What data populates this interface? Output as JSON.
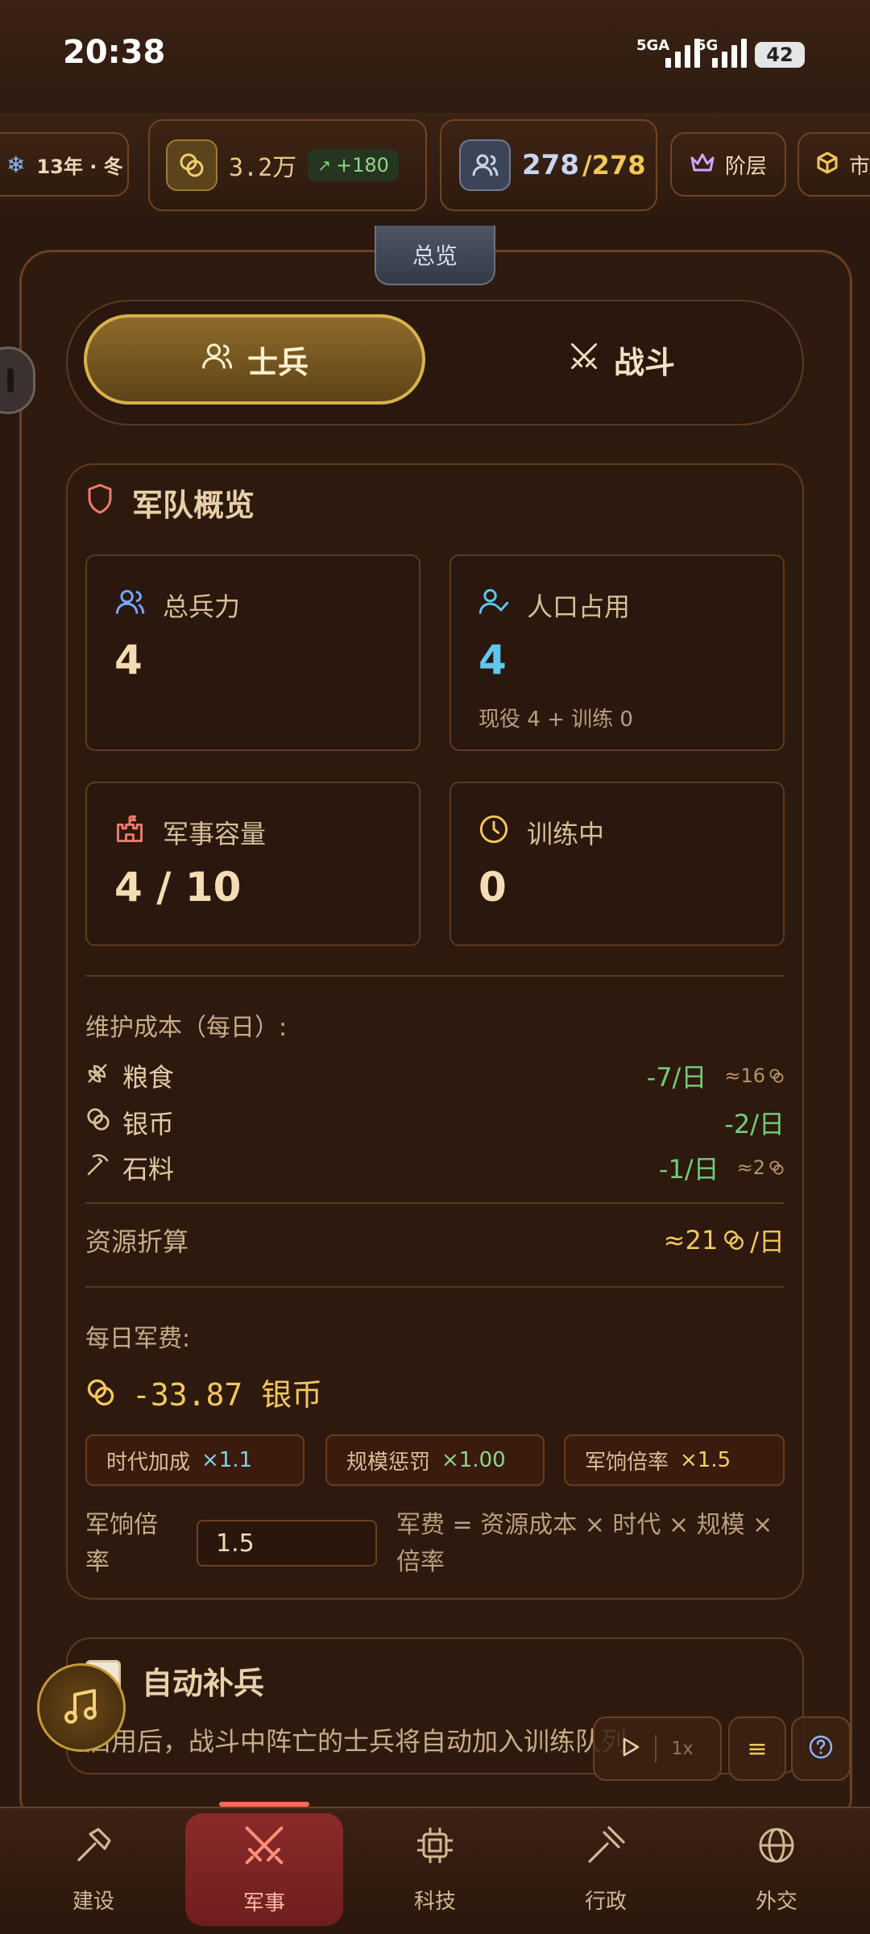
{
  "status_bar": {
    "time": "20:38",
    "network1": "5GA",
    "network2": "5G",
    "battery": "42"
  },
  "resources": {
    "season": "13年 · 冬",
    "silver": "3.2万",
    "silver_delta": "+180",
    "population_current": "278",
    "population_max": "/278",
    "class_label": "阶层",
    "market_label": "市"
  },
  "overview_tab": "总览",
  "segment": {
    "soldiers": "士兵",
    "battle": "战斗"
  },
  "army_overview": {
    "title": "军队概览",
    "total_troops_label": "总兵力",
    "total_troops_value": "4",
    "population_usage_label": "人口占用",
    "population_usage_value": "4",
    "population_usage_sub": "现役 4 + 训练 0",
    "military_capacity_label": "军事容量",
    "military_capacity_value": "4 / 10",
    "training_label": "训练中",
    "training_value": "0"
  },
  "maintenance": {
    "title": "维护成本（每日）:",
    "items": [
      {
        "name": "粮食",
        "amount": "-7/日",
        "equiv": "≈16",
        "icon": "wheat-icon"
      },
      {
        "name": "银币",
        "amount": "-2/日",
        "equiv": "",
        "icon": "coins-icon"
      },
      {
        "name": "石料",
        "amount": "-1/日",
        "equiv": "≈2",
        "icon": "pickaxe-icon"
      }
    ],
    "conversion_label": "资源折算",
    "conversion_value": "≈21",
    "conversion_unit": "/日"
  },
  "daily_cost": {
    "label": "每日军费:",
    "value": "-33.87 银币",
    "modifiers": [
      {
        "label": "时代加成",
        "mult": "×1.1"
      },
      {
        "label": "规模惩罚",
        "mult": "×1.00"
      },
      {
        "label": "军饷倍率",
        "mult": "×1.5"
      }
    ],
    "pay_rate_label": "军饷倍率",
    "pay_rate_value": "1.5",
    "formula": "军费 = 资源成本 × 时代 × 规模 × 倍率"
  },
  "auto_reinforce": {
    "title": "自动补兵",
    "description": "启用后，战斗中阵亡的士兵将自动加入训练队列。"
  },
  "controls": {
    "speed": "1x"
  },
  "bottom_nav": {
    "items": [
      {
        "label": "建设",
        "icon": "hammer-icon"
      },
      {
        "label": "军事",
        "icon": "swords-icon"
      },
      {
        "label": "科技",
        "icon": "chip-icon"
      },
      {
        "label": "行政",
        "icon": "gavel-icon"
      },
      {
        "label": "外交",
        "icon": "globe-icon"
      }
    ],
    "active": "军事"
  },
  "colors": {
    "accent_gold": "#d8b24a",
    "positive": "#6fcf7a",
    "cyan": "#5ec8ef",
    "active_nav": "#8b2a2a"
  }
}
